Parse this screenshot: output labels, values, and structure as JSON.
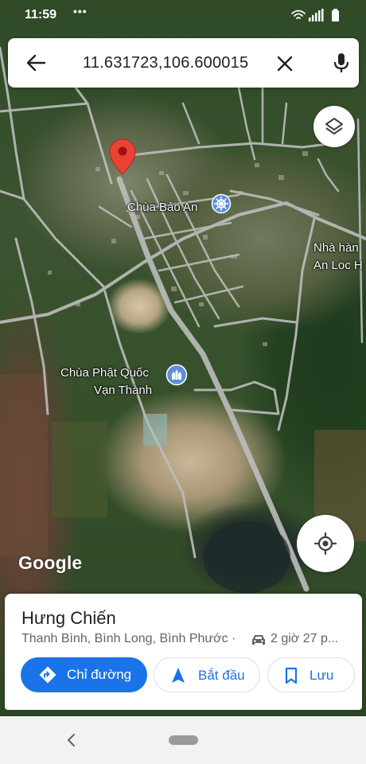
{
  "status_bar": {
    "time": "11:59",
    "dots": "•••"
  },
  "search": {
    "query": "11.631723,106.600015"
  },
  "map": {
    "labels": {
      "temple_1": "Chùa Bảo An",
      "restaurant_line1": "Nhà hàn",
      "restaurant_line2": "An Loc H",
      "temple_2_line1": "Chùa Phật Quốc",
      "temple_2_line2": "Vạn Thành"
    },
    "logo": "Google",
    "pin_color": "#ea4335"
  },
  "place_card": {
    "name": "Hưng Chiến",
    "address": "Thanh Bình, Bình Long, Bình Phước ·",
    "duration": "2 giờ 27 p...",
    "buttons": {
      "directions": "Chỉ đường",
      "start": "Bắt đầu",
      "save": "Lưu"
    }
  },
  "colors": {
    "accent": "#1a73e8",
    "card_bg": "#ffffff",
    "secondary_text": "#5f6368"
  }
}
